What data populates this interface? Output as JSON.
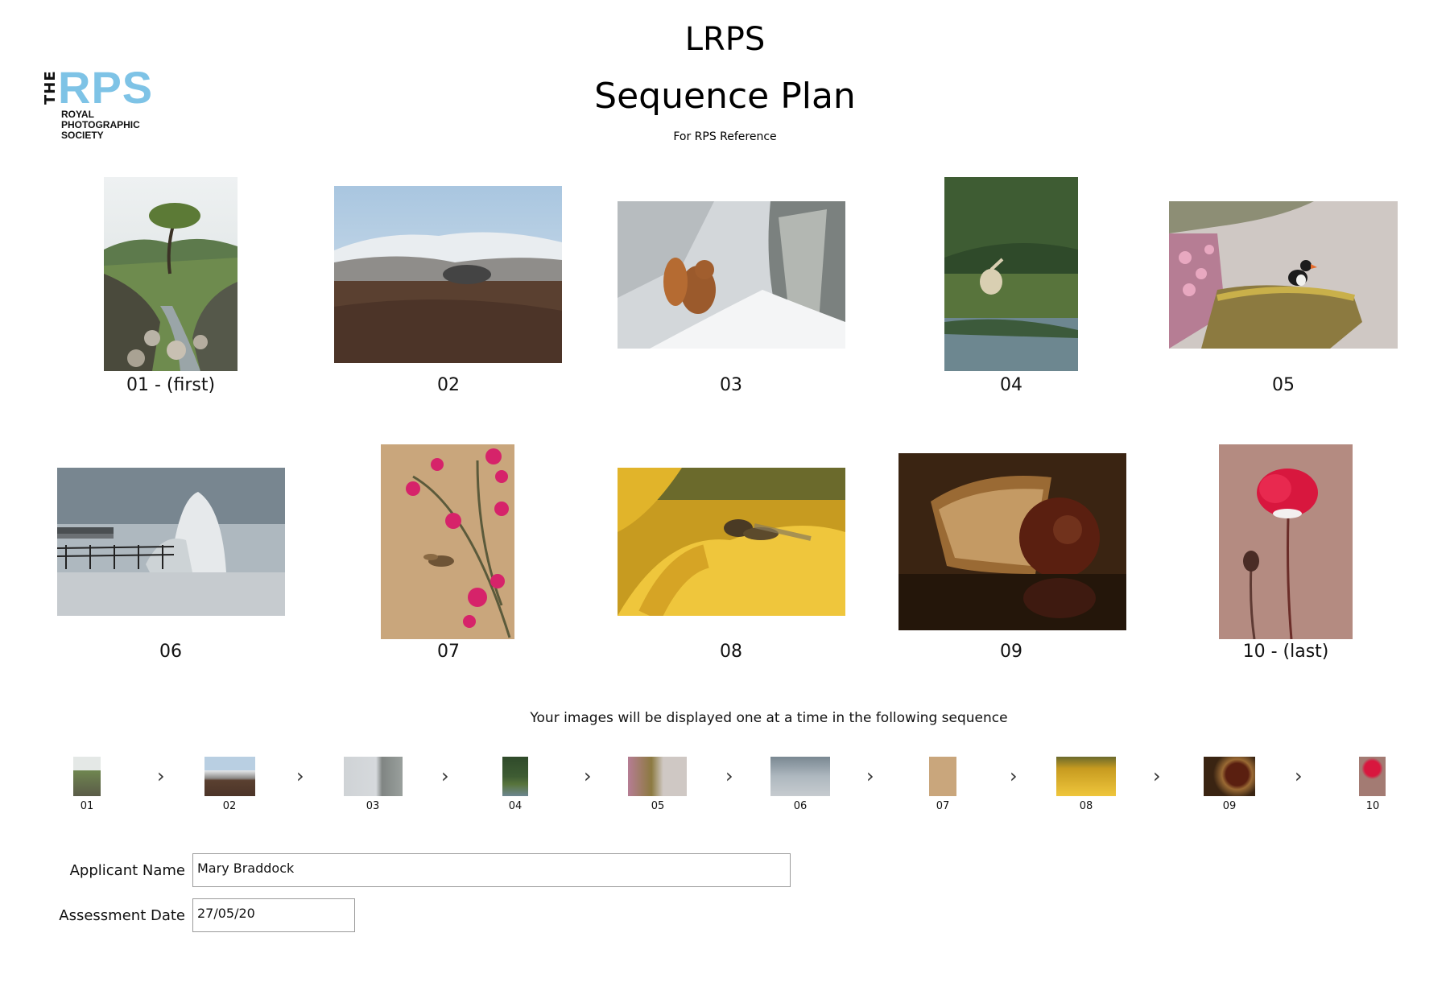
{
  "header": {
    "title": "LRPS",
    "subtitle": "Sequence Plan",
    "note": "For RPS Reference"
  },
  "logo": {
    "the": "THE",
    "rps": "RPS",
    "line1": "ROYAL",
    "line2": "PHOTOGRAPHIC",
    "line3": "SOCIETY",
    "color": "#7ec3e6"
  },
  "images": [
    {
      "label": "01 - (first)",
      "subject": "tree by stream"
    },
    {
      "label": "02",
      "subject": "snowy mountain landscape"
    },
    {
      "label": "03",
      "subject": "red squirrel in snow"
    },
    {
      "label": "04",
      "subject": "heron in reeds"
    },
    {
      "label": "05",
      "subject": "puffin on rocks"
    },
    {
      "label": "06",
      "subject": "wave at pier"
    },
    {
      "label": "07",
      "subject": "hawk-moth and pink flowers"
    },
    {
      "label": "08",
      "subject": "hoverfly on yellow flower"
    },
    {
      "label": "09",
      "subject": "conker"
    },
    {
      "label": "10 - (last)",
      "subject": "red poppy"
    }
  ],
  "sequence": {
    "intro": "Your images will be displayed one at a time in the following sequence",
    "labels": [
      "01",
      "02",
      "03",
      "04",
      "05",
      "06",
      "07",
      "08",
      "09",
      "10"
    ],
    "arrow": "›"
  },
  "form": {
    "name_label": "Applicant Name",
    "name_value": "Mary Braddock",
    "date_label": "Assessment Date",
    "date_value": "27/05/20"
  }
}
